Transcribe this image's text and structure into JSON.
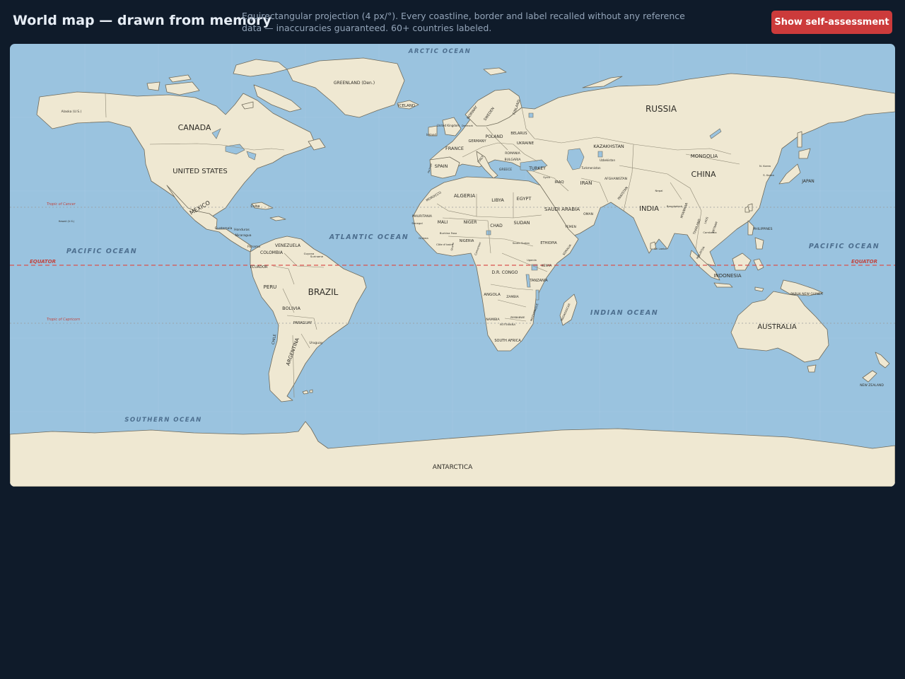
{
  "header": {
    "title": "World map — drawn from memory",
    "description": "Equirectangular projection (4 px/°). Every coastline, border and label recalled without any reference data — inaccuracies guaranteed. 60+ countries labeled.",
    "button_label": "Show self-assessment"
  },
  "colors": {
    "ocean": "#9ac3df",
    "land": "#efe8d2",
    "accent_button": "#cc3b3b",
    "equator": "#d9534f"
  },
  "map": {
    "ocean_labels": {
      "arctic": "ARCTIC OCEAN",
      "atlantic": "ATLANTIC OCEAN",
      "pacific_west": "PACIFIC OCEAN",
      "pacific_east": "PACIFIC OCEAN",
      "indian": "INDIAN OCEAN",
      "southern": "SOUTHERN OCEAN"
    },
    "lines": {
      "equator_left": "EQUATOR",
      "equator_right": "EQUATOR",
      "cancer": "Tropic of Cancer",
      "capricorn": "Tropic of Capricorn"
    },
    "countries": {
      "canada": "CANADA",
      "usa": "UNITED STATES",
      "alaska": "Alaska (U.S.)",
      "mexico": "MEXICO",
      "greenland": "GREENLAND (Den.)",
      "iceland": "ICELAND",
      "cuba": "Cuba",
      "guatemala": "Guatemala",
      "honduras": "Honduras",
      "nicaragua": "Nicaragua",
      "panama": "Panama",
      "hawaii": "Hawaii (U.S.)",
      "venezuela": "VENEZUELA",
      "colombia": "COLOMBIA",
      "ecuador": "ECUADOR",
      "guyana": "Guyana",
      "suriname": "Suriname",
      "peru": "PERU",
      "brazil": "BRAZIL",
      "bolivia": "BOLIVIA",
      "paraguay": "PARAGUAY",
      "uruguay": "Uruguay",
      "chile": "CHILE",
      "argentina": "ARGENTINA",
      "ireland": "Ireland",
      "uk": "United Kingdom",
      "denmark": "Denmark",
      "norway": "NORWAY",
      "sweden": "SWEDEN",
      "finland": "FINLAND",
      "france": "FRANCE",
      "spain": "SPAIN",
      "portugal": "Portugal",
      "germany": "GERMANY",
      "poland": "POLAND",
      "italy": "ITALY",
      "belarus": "BELARUS",
      "ukraine": "UKRAINE",
      "romania": "ROMANIA",
      "bulgaria": "BULGARIA",
      "greece": "GREECE",
      "turkey": "TURKEY",
      "russia": "RUSSIA",
      "kazakhstan": "KAZAKHSTAN",
      "uzbekistan": "Uzbekistan",
      "turkmenistan": "Turkmenistan",
      "mongolia": "MONGOLIA",
      "china": "CHINA",
      "nkorea": "N. Korea",
      "skorea": "S. Korea",
      "japan": "JAPAN",
      "afghanistan": "AFGHANISTAN",
      "pakistan": "PAKISTAN",
      "iran": "IRAN",
      "iraq": "IRAQ",
      "syria": "Syria",
      "saudi": "SAUDI ARABIA",
      "oman": "OMAN",
      "yemen": "YEMEN",
      "india": "INDIA",
      "nepal": "Nepal",
      "bangladesh": "Bangladesh",
      "srilanka": "Sri Lanka",
      "myanmar": "MYANMAR",
      "thailand": "THAILAND",
      "laos": "LAOS",
      "vietnam": "VIETNAM",
      "cambodia": "Cambodia",
      "malaysia": "MALAYSIA",
      "philippines": "PHILIPPINES",
      "indonesia": "INDONESIA",
      "png": "PAPUA NEW GUINEA",
      "australia": "AUSTRALIA",
      "newzealand": "NEW ZEALAND",
      "morocco": "MOROCCO",
      "algeria": "ALGERIA",
      "libya": "LIBYA",
      "egypt": "EGYPT",
      "mauritania": "MAURITANIA",
      "mali": "MALI",
      "niger": "NIGER",
      "chad": "CHAD",
      "sudan": "SUDAN",
      "senegal": "Senegal",
      "guinea": "Guinea",
      "burkinafaso": "Burkina Faso",
      "cotedivoire": "Côte d'Ivoire",
      "ghana": "Ghana",
      "nigeria": "NIGERIA",
      "cameroon": "Cameroon",
      "southsudan": "South Sudan",
      "ethiopia": "ETHIOPIA",
      "somalia": "SOMALIA",
      "uganda": "Uganda",
      "kenya": "KENYA",
      "drcongo": "D.R. CONGO",
      "tanzania": "TANZANIA",
      "angola": "ANGOLA",
      "zambia": "ZAMBIA",
      "mozambique": "MOZAMBIQUE",
      "zimbabwe": "ZIMBABWE",
      "namibia": "NAMIBIA",
      "botswana": "BOTSWANA",
      "southafrica": "SOUTH AFRICA",
      "madagascar": "MADAGASCAR",
      "antarctica": "ANTARCTICA"
    }
  }
}
